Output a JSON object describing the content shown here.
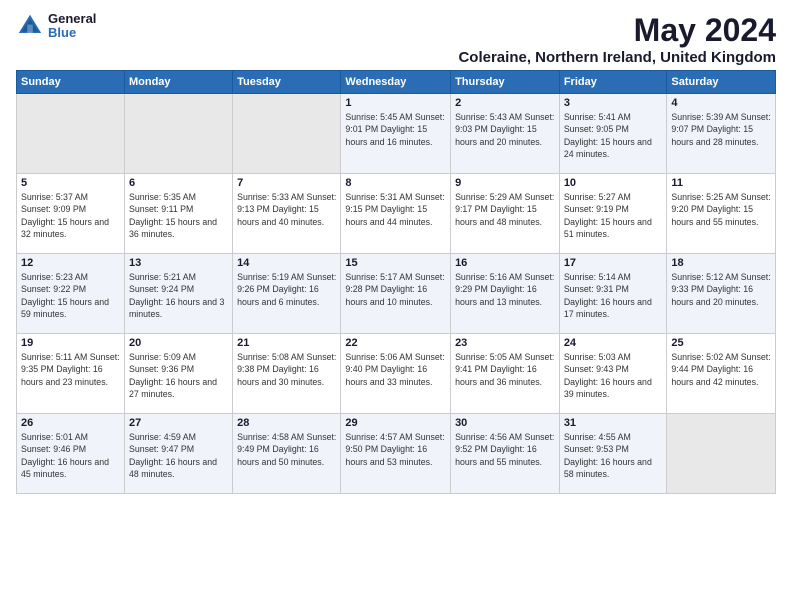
{
  "logo": {
    "general": "General",
    "blue": "Blue"
  },
  "title": "May 2024",
  "subtitle": "Coleraine, Northern Ireland, United Kingdom",
  "days_of_week": [
    "Sunday",
    "Monday",
    "Tuesday",
    "Wednesday",
    "Thursday",
    "Friday",
    "Saturday"
  ],
  "weeks": [
    [
      {
        "num": "",
        "info": ""
      },
      {
        "num": "",
        "info": ""
      },
      {
        "num": "",
        "info": ""
      },
      {
        "num": "1",
        "info": "Sunrise: 5:45 AM\nSunset: 9:01 PM\nDaylight: 15 hours\nand 16 minutes."
      },
      {
        "num": "2",
        "info": "Sunrise: 5:43 AM\nSunset: 9:03 PM\nDaylight: 15 hours\nand 20 minutes."
      },
      {
        "num": "3",
        "info": "Sunrise: 5:41 AM\nSunset: 9:05 PM\nDaylight: 15 hours\nand 24 minutes."
      },
      {
        "num": "4",
        "info": "Sunrise: 5:39 AM\nSunset: 9:07 PM\nDaylight: 15 hours\nand 28 minutes."
      }
    ],
    [
      {
        "num": "5",
        "info": "Sunrise: 5:37 AM\nSunset: 9:09 PM\nDaylight: 15 hours\nand 32 minutes."
      },
      {
        "num": "6",
        "info": "Sunrise: 5:35 AM\nSunset: 9:11 PM\nDaylight: 15 hours\nand 36 minutes."
      },
      {
        "num": "7",
        "info": "Sunrise: 5:33 AM\nSunset: 9:13 PM\nDaylight: 15 hours\nand 40 minutes."
      },
      {
        "num": "8",
        "info": "Sunrise: 5:31 AM\nSunset: 9:15 PM\nDaylight: 15 hours\nand 44 minutes."
      },
      {
        "num": "9",
        "info": "Sunrise: 5:29 AM\nSunset: 9:17 PM\nDaylight: 15 hours\nand 48 minutes."
      },
      {
        "num": "10",
        "info": "Sunrise: 5:27 AM\nSunset: 9:19 PM\nDaylight: 15 hours\nand 51 minutes."
      },
      {
        "num": "11",
        "info": "Sunrise: 5:25 AM\nSunset: 9:20 PM\nDaylight: 15 hours\nand 55 minutes."
      }
    ],
    [
      {
        "num": "12",
        "info": "Sunrise: 5:23 AM\nSunset: 9:22 PM\nDaylight: 15 hours\nand 59 minutes."
      },
      {
        "num": "13",
        "info": "Sunrise: 5:21 AM\nSunset: 9:24 PM\nDaylight: 16 hours\nand 3 minutes."
      },
      {
        "num": "14",
        "info": "Sunrise: 5:19 AM\nSunset: 9:26 PM\nDaylight: 16 hours\nand 6 minutes."
      },
      {
        "num": "15",
        "info": "Sunrise: 5:17 AM\nSunset: 9:28 PM\nDaylight: 16 hours\nand 10 minutes."
      },
      {
        "num": "16",
        "info": "Sunrise: 5:16 AM\nSunset: 9:29 PM\nDaylight: 16 hours\nand 13 minutes."
      },
      {
        "num": "17",
        "info": "Sunrise: 5:14 AM\nSunset: 9:31 PM\nDaylight: 16 hours\nand 17 minutes."
      },
      {
        "num": "18",
        "info": "Sunrise: 5:12 AM\nSunset: 9:33 PM\nDaylight: 16 hours\nand 20 minutes."
      }
    ],
    [
      {
        "num": "19",
        "info": "Sunrise: 5:11 AM\nSunset: 9:35 PM\nDaylight: 16 hours\nand 23 minutes."
      },
      {
        "num": "20",
        "info": "Sunrise: 5:09 AM\nSunset: 9:36 PM\nDaylight: 16 hours\nand 27 minutes."
      },
      {
        "num": "21",
        "info": "Sunrise: 5:08 AM\nSunset: 9:38 PM\nDaylight: 16 hours\nand 30 minutes."
      },
      {
        "num": "22",
        "info": "Sunrise: 5:06 AM\nSunset: 9:40 PM\nDaylight: 16 hours\nand 33 minutes."
      },
      {
        "num": "23",
        "info": "Sunrise: 5:05 AM\nSunset: 9:41 PM\nDaylight: 16 hours\nand 36 minutes."
      },
      {
        "num": "24",
        "info": "Sunrise: 5:03 AM\nSunset: 9:43 PM\nDaylight: 16 hours\nand 39 minutes."
      },
      {
        "num": "25",
        "info": "Sunrise: 5:02 AM\nSunset: 9:44 PM\nDaylight: 16 hours\nand 42 minutes."
      }
    ],
    [
      {
        "num": "26",
        "info": "Sunrise: 5:01 AM\nSunset: 9:46 PM\nDaylight: 16 hours\nand 45 minutes."
      },
      {
        "num": "27",
        "info": "Sunrise: 4:59 AM\nSunset: 9:47 PM\nDaylight: 16 hours\nand 48 minutes."
      },
      {
        "num": "28",
        "info": "Sunrise: 4:58 AM\nSunset: 9:49 PM\nDaylight: 16 hours\nand 50 minutes."
      },
      {
        "num": "29",
        "info": "Sunrise: 4:57 AM\nSunset: 9:50 PM\nDaylight: 16 hours\nand 53 minutes."
      },
      {
        "num": "30",
        "info": "Sunrise: 4:56 AM\nSunset: 9:52 PM\nDaylight: 16 hours\nand 55 minutes."
      },
      {
        "num": "31",
        "info": "Sunrise: 4:55 AM\nSunset: 9:53 PM\nDaylight: 16 hours\nand 58 minutes."
      },
      {
        "num": "",
        "info": ""
      }
    ]
  ]
}
